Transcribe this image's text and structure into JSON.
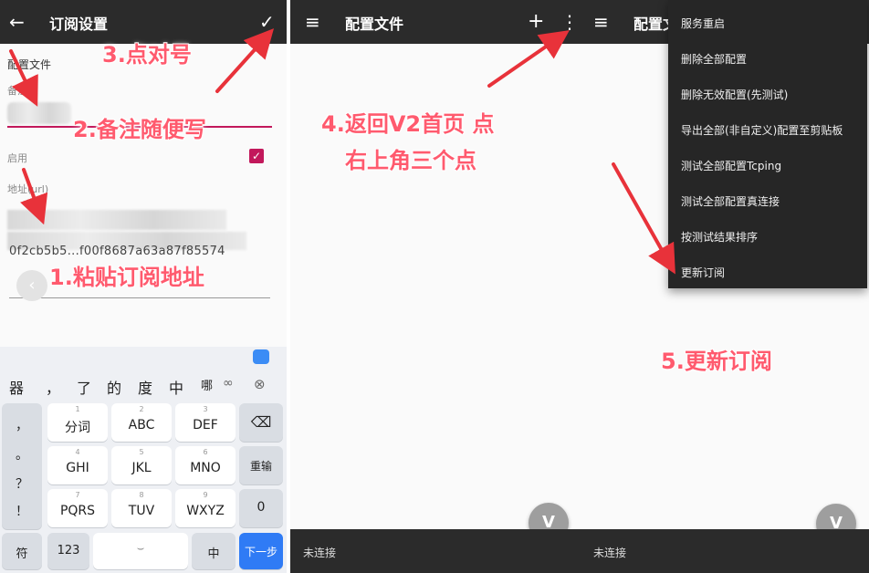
{
  "left": {
    "title": "订阅设置",
    "back_icon": "←",
    "check_icon": "✓",
    "section": "配置文件",
    "remark_label": "备注",
    "enabled_label": "启用",
    "checkbox_mark": "✓",
    "url_label": "地址(url)",
    "url_tail": "0f2cb5b5...f00f8687a63a87f85574",
    "keyboard": {
      "candidates": [
        "器",
        "，",
        "了",
        "的",
        "度",
        "中",
        "哪"
      ],
      "row1": [
        {
          "sub": "1",
          "main": "分词"
        },
        {
          "sub": "2",
          "main": "ABC"
        },
        {
          "sub": "3",
          "main": "DEF"
        }
      ],
      "row2": [
        {
          "sub": "4",
          "main": "GHI"
        },
        {
          "sub": "5",
          "main": "JKL"
        },
        {
          "sub": "6",
          "main": "MNO"
        }
      ],
      "row3": [
        {
          "sub": "7",
          "main": "PQRS"
        },
        {
          "sub": "8",
          "main": "TUV"
        },
        {
          "sub": "9",
          "main": "WXYZ"
        }
      ],
      "side_keys": [
        "，",
        "。",
        "？",
        "！"
      ],
      "retype": "重输",
      "zero": "0",
      "backspace": "⌫",
      "symbol": "符",
      "num": "123",
      "lang": "中",
      "next": "下一步",
      "space_icon": "mic",
      "clear_icon": "⊗"
    }
  },
  "middle": {
    "title": "配置文件",
    "menu_icon": "≡",
    "plus_icon": "+",
    "more_icon": "⋮",
    "status": "未连接",
    "fab_icon": "V"
  },
  "right": {
    "title": "配置文",
    "menu_icon": "≡",
    "status": "未连接",
    "fab_icon": "V",
    "menu_items": [
      "服务重启",
      "删除全部配置",
      "删除无效配置(先测试)",
      "导出全部(非自定义)配置至剪贴板",
      "测试全部配置Tcping",
      "测试全部配置真连接",
      "按测试结果排序",
      "更新订阅"
    ]
  },
  "annotations": {
    "a1": "1.粘贴订阅地址",
    "a2": "2.备注随便写",
    "a3": "3.点对号",
    "a4a": "4.返回V2首页 点",
    "a4b": "右上角三个点",
    "a5": "5.更新订阅"
  },
  "colors": {
    "appbar": "#2b2b2b",
    "accent": "#c2185b",
    "annotation": "#ff5a6e",
    "next_key": "#2f7bf5"
  }
}
